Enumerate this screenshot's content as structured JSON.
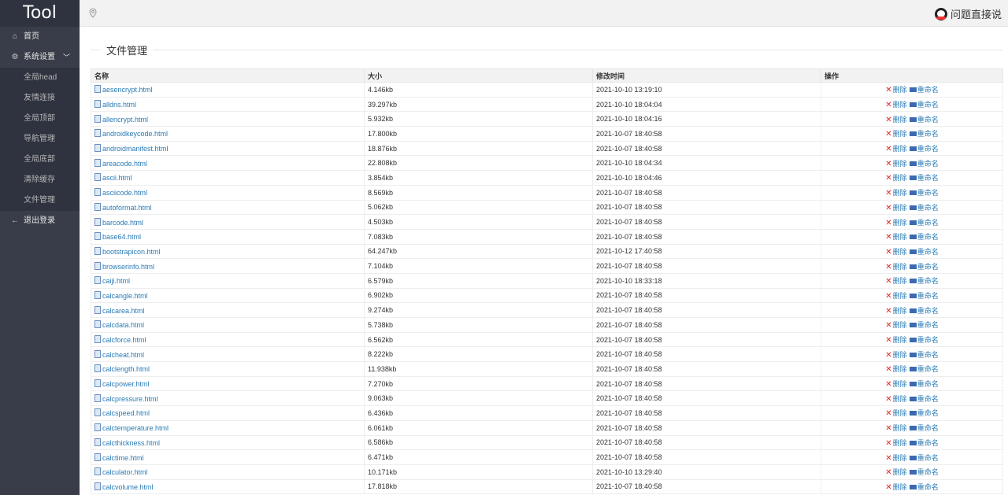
{
  "sidebar": {
    "logo": "Tool",
    "home": "首页",
    "settings": "系统设置",
    "sub": [
      "全局head",
      "友情连接",
      "全局顶部",
      "导航管理",
      "全局底部",
      "清除缓存",
      "文件管理"
    ],
    "logout": "退出登录"
  },
  "topbar": {
    "help": "问题直接说"
  },
  "main": {
    "legend": "文件管理",
    "headers": [
      "名称",
      "大小",
      "修改时间",
      "操作"
    ],
    "delete_label": "删除",
    "rename_label": "重命名",
    "rows": [
      [
        "aesencrypt.html",
        "4.146kb",
        "2021-10-10 13:19:10"
      ],
      [
        "alldns.html",
        "39.297kb",
        "2021-10-10 18:04:04"
      ],
      [
        "allencrypt.html",
        "5.932kb",
        "2021-10-10 18:04:16"
      ],
      [
        "androidkeycode.html",
        "17.800kb",
        "2021-10-07 18:40:58"
      ],
      [
        "androidmanifest.html",
        "18.876kb",
        "2021-10-07 18:40:58"
      ],
      [
        "areacode.html",
        "22.808kb",
        "2021-10-10 18:04:34"
      ],
      [
        "ascii.html",
        "3.854kb",
        "2021-10-10 18:04:46"
      ],
      [
        "asciicode.html",
        "8.569kb",
        "2021-10-07 18:40:58"
      ],
      [
        "autoformat.html",
        "5.062kb",
        "2021-10-07 18:40:58"
      ],
      [
        "barcode.html",
        "4.503kb",
        "2021-10-07 18:40:58"
      ],
      [
        "base64.html",
        "7.083kb",
        "2021-10-07 18:40:58"
      ],
      [
        "bootstrapicon.html",
        "64.247kb",
        "2021-10-12 17:40:58"
      ],
      [
        "browserinfo.html",
        "7.104kb",
        "2021-10-07 18:40:58"
      ],
      [
        "caiji.html",
        "6.579kb",
        "2021-10-10 18:33:18"
      ],
      [
        "calcangle.html",
        "6.902kb",
        "2021-10-07 18:40:58"
      ],
      [
        "calcarea.html",
        "9.274kb",
        "2021-10-07 18:40:58"
      ],
      [
        "calcdata.html",
        "5.738kb",
        "2021-10-07 18:40:58"
      ],
      [
        "calcforce.html",
        "6.562kb",
        "2021-10-07 18:40:58"
      ],
      [
        "calcheat.html",
        "8.222kb",
        "2021-10-07 18:40:58"
      ],
      [
        "calclength.html",
        "11.938kb",
        "2021-10-07 18:40:58"
      ],
      [
        "calcpower.html",
        "7.270kb",
        "2021-10-07 18:40:58"
      ],
      [
        "calcpressure.html",
        "9.063kb",
        "2021-10-07 18:40:58"
      ],
      [
        "calcspeed.html",
        "6.436kb",
        "2021-10-07 18:40:58"
      ],
      [
        "calctemperature.html",
        "6.061kb",
        "2021-10-07 18:40:58"
      ],
      [
        "calcthickness.html",
        "6.586kb",
        "2021-10-07 18:40:58"
      ],
      [
        "calctime.html",
        "6.471kb",
        "2021-10-07 18:40:58"
      ],
      [
        "calculator.html",
        "10.171kb",
        "2021-10-10 13:29:40"
      ],
      [
        "calcvolume.html",
        "17.818kb",
        "2021-10-07 18:40:58"
      ]
    ]
  }
}
